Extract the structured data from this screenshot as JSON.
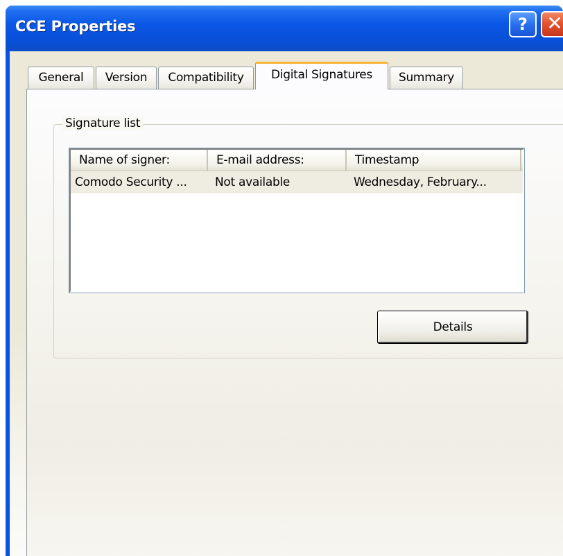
{
  "window": {
    "title": "CCE Properties",
    "help_label": "?",
    "close_label": "✕"
  },
  "tabs": [
    {
      "label": "General",
      "active": false
    },
    {
      "label": "Version",
      "active": false
    },
    {
      "label": "Compatibility",
      "active": false
    },
    {
      "label": "Digital Signatures",
      "active": true
    },
    {
      "label": "Summary",
      "active": false
    }
  ],
  "signature_group": {
    "label": "Signature list",
    "columns": [
      "Name of signer:",
      "E-mail address:",
      "Timestamp"
    ],
    "rows": [
      {
        "name": "Comodo Security ...",
        "email": "Not available",
        "timestamp": "Wednesday, February..."
      }
    ],
    "details_label": "Details"
  },
  "colors": {
    "titlebar": "#0a54e3",
    "active_tab_accent": "#f8b436",
    "close_button": "#e4532f"
  }
}
